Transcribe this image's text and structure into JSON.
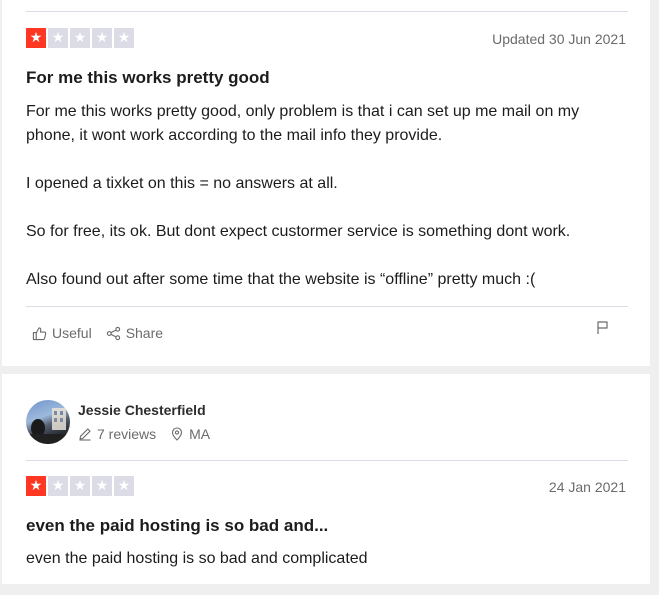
{
  "reviews": [
    {
      "rating": 1,
      "max_rating": 5,
      "date": "Updated 30 Jun 2021",
      "title": "For me this works pretty good",
      "paragraphs": [
        "For me this works pretty good, only problem is that i can set up me mail on my phone, it wont work according to the mail info they provide.",
        "I opened a tixket on this = no answers at all.",
        "So for free, its ok. But dont expect custormer service is something dont work.",
        "Also found out after some time that the website is “offline” pretty much :("
      ],
      "actions": {
        "useful_label": "Useful",
        "share_label": "Share"
      }
    },
    {
      "reviewer": {
        "name": "Jessie Chesterfield",
        "reviews_count": "7 reviews",
        "location": "MA"
      },
      "rating": 1,
      "max_rating": 5,
      "date": "24 Jan 2021",
      "title": "even the paid hosting is so bad and...",
      "paragraphs": [
        "even the paid hosting is so bad and complicated"
      ]
    }
  ],
  "colors": {
    "star_on": "#ff3722",
    "star_off": "#dcdce6",
    "muted_text": "#6b6b6b"
  },
  "icons": [
    "star-icon",
    "thumbs-up-icon",
    "share-icon",
    "flag-icon",
    "pencil-icon",
    "location-pin-icon"
  ]
}
